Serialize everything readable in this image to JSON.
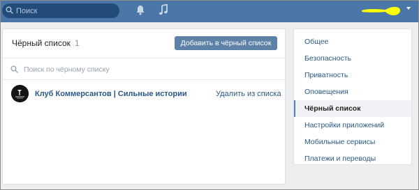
{
  "header": {
    "search_placeholder": "Поиск",
    "icons": [
      "search-icon",
      "bell-icon",
      "music-icon"
    ],
    "accent_color": "#4a76a8",
    "user_mark_color": "#ffff00"
  },
  "blacklist": {
    "title": "Чёрный список",
    "count": "1",
    "add_button": "Добавить в чёрный список",
    "search_placeholder": "Поиск по чёрному списку",
    "items": [
      {
        "name": "Клуб Коммерсантов | Сильные истории",
        "action": "Удалить из списка"
      }
    ]
  },
  "menu": {
    "items": [
      {
        "label": "Общее",
        "active": false
      },
      {
        "label": "Безопасность",
        "active": false
      },
      {
        "label": "Приватность",
        "active": false
      },
      {
        "label": "Оповещения",
        "active": false
      },
      {
        "label": "Чёрный список",
        "active": true
      },
      {
        "label": "Настройки приложений",
        "active": false
      },
      {
        "label": "Мобильные сервисы",
        "active": false
      },
      {
        "label": "Платежи и переводы",
        "active": false
      }
    ]
  }
}
